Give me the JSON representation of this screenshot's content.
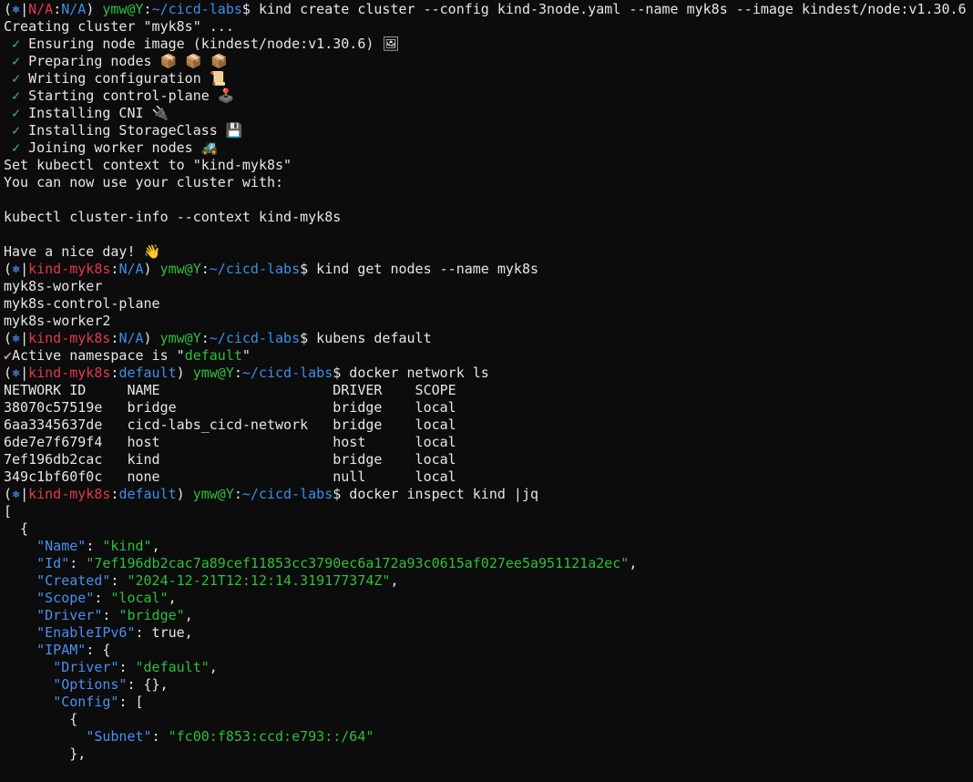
{
  "colors": {
    "background": "#0c0c0c",
    "text": "#cccccc",
    "red": "#e23a4a",
    "blue": "#3b8eea",
    "green": "#2fbf3a",
    "json_key": "#4a8ff0"
  },
  "terminal": {
    "lines": [
      [
        {
          "t": "(",
          "c": "white"
        },
        {
          "t": "⎈",
          "c": "k8s"
        },
        {
          "t": "|",
          "c": "white"
        },
        {
          "t": "N/A",
          "c": "red"
        },
        {
          "t": ":",
          "c": "white"
        },
        {
          "t": "N/A",
          "c": "blue"
        },
        {
          "t": ") ",
          "c": "white"
        },
        {
          "t": "ymw@Y",
          "c": "green"
        },
        {
          "t": ":",
          "c": "white"
        },
        {
          "t": "~/cicd-labs",
          "c": "blue"
        },
        {
          "t": "$ kind create cluster --config kind-3node.yaml --name myk8s --image kindest/node:v1.30.6",
          "c": "white"
        }
      ],
      [
        {
          "t": "Creating cluster \"myk8s\" ...",
          "c": "white"
        }
      ],
      [
        {
          "t": " ✓",
          "c": "check"
        },
        {
          "t": " Ensuring node image (kindest/node:v1.30.6) 🖼",
          "c": "white"
        }
      ],
      [
        {
          "t": " ✓",
          "c": "check"
        },
        {
          "t": " Preparing nodes 📦 📦 📦",
          "c": "white"
        }
      ],
      [
        {
          "t": " ✓",
          "c": "check"
        },
        {
          "t": " Writing configuration 📜",
          "c": "white"
        }
      ],
      [
        {
          "t": " ✓",
          "c": "check"
        },
        {
          "t": " Starting control-plane 🕹️",
          "c": "white"
        }
      ],
      [
        {
          "t": " ✓",
          "c": "check"
        },
        {
          "t": " Installing CNI 🔌",
          "c": "white"
        }
      ],
      [
        {
          "t": " ✓",
          "c": "check"
        },
        {
          "t": " Installing StorageClass 💾",
          "c": "white"
        }
      ],
      [
        {
          "t": " ✓",
          "c": "check"
        },
        {
          "t": " Joining worker nodes 🚜",
          "c": "white"
        }
      ],
      [
        {
          "t": "Set kubectl context to \"kind-myk8s\"",
          "c": "white"
        }
      ],
      [
        {
          "t": "You can now use your cluster with:",
          "c": "white"
        }
      ],
      [
        {
          "t": "",
          "c": "white"
        }
      ],
      [
        {
          "t": "kubectl cluster-info --context kind-myk8s",
          "c": "white"
        }
      ],
      [
        {
          "t": "",
          "c": "white"
        }
      ],
      [
        {
          "t": "Have a nice day! 👋",
          "c": "white"
        }
      ],
      [
        {
          "t": "(",
          "c": "white"
        },
        {
          "t": "⎈",
          "c": "k8s"
        },
        {
          "t": "|",
          "c": "white"
        },
        {
          "t": "kind-myk8s",
          "c": "red"
        },
        {
          "t": ":",
          "c": "white"
        },
        {
          "t": "N/A",
          "c": "blue"
        },
        {
          "t": ") ",
          "c": "white"
        },
        {
          "t": "ymw@Y",
          "c": "green"
        },
        {
          "t": ":",
          "c": "white"
        },
        {
          "t": "~/cicd-labs",
          "c": "blue"
        },
        {
          "t": "$ kind get nodes --name myk8s",
          "c": "white"
        }
      ],
      [
        {
          "t": "myk8s-worker",
          "c": "white"
        }
      ],
      [
        {
          "t": "myk8s-control-plane",
          "c": "white"
        }
      ],
      [
        {
          "t": "myk8s-worker2",
          "c": "white"
        }
      ],
      [
        {
          "t": "(",
          "c": "white"
        },
        {
          "t": "⎈",
          "c": "k8s"
        },
        {
          "t": "|",
          "c": "white"
        },
        {
          "t": "kind-myk8s",
          "c": "red"
        },
        {
          "t": ":",
          "c": "white"
        },
        {
          "t": "N/A",
          "c": "blue"
        },
        {
          "t": ") ",
          "c": "white"
        },
        {
          "t": "ymw@Y",
          "c": "green"
        },
        {
          "t": ":",
          "c": "white"
        },
        {
          "t": "~/cicd-labs",
          "c": "blue"
        },
        {
          "t": "$ kubens default",
          "c": "white"
        }
      ],
      [
        {
          "t": "✔",
          "c": "purple"
        },
        {
          "t": "Active namespace is \"",
          "c": "white"
        },
        {
          "t": "default",
          "c": "green"
        },
        {
          "t": "\"",
          "c": "white"
        }
      ],
      [
        {
          "t": "(",
          "c": "white"
        },
        {
          "t": "⎈",
          "c": "k8s"
        },
        {
          "t": "|",
          "c": "white"
        },
        {
          "t": "kind-myk8s",
          "c": "red"
        },
        {
          "t": ":",
          "c": "white"
        },
        {
          "t": "default",
          "c": "blue"
        },
        {
          "t": ") ",
          "c": "white"
        },
        {
          "t": "ymw@Y",
          "c": "green"
        },
        {
          "t": ":",
          "c": "white"
        },
        {
          "t": "~/cicd-labs",
          "c": "blue"
        },
        {
          "t": "$ docker network ls",
          "c": "white"
        }
      ],
      [
        {
          "t": "NETWORK ID     NAME                     DRIVER    SCOPE",
          "c": "white"
        }
      ],
      [
        {
          "t": "38070c57519e   bridge                   bridge    local",
          "c": "white"
        }
      ],
      [
        {
          "t": "6aa3345637de   cicd-labs_cicd-network   bridge    local",
          "c": "white"
        }
      ],
      [
        {
          "t": "6de7e7f679f4   host                     host      local",
          "c": "white"
        }
      ],
      [
        {
          "t": "7ef196db2cac   kind                     bridge    local",
          "c": "white"
        }
      ],
      [
        {
          "t": "349c1bf60f0c   none                     null      local",
          "c": "white"
        }
      ],
      [
        {
          "t": "(",
          "c": "white"
        },
        {
          "t": "⎈",
          "c": "k8s"
        },
        {
          "t": "|",
          "c": "white"
        },
        {
          "t": "kind-myk8s",
          "c": "red"
        },
        {
          "t": ":",
          "c": "white"
        },
        {
          "t": "default",
          "c": "blue"
        },
        {
          "t": ") ",
          "c": "white"
        },
        {
          "t": "ymw@Y",
          "c": "green"
        },
        {
          "t": ":",
          "c": "white"
        },
        {
          "t": "~/cicd-labs",
          "c": "blue"
        },
        {
          "t": "$ docker inspect kind |jq",
          "c": "white"
        }
      ],
      [
        {
          "t": "[",
          "c": "json-punct"
        }
      ],
      [
        {
          "t": "  {",
          "c": "json-punct"
        }
      ],
      [
        {
          "t": "    ",
          "c": "white"
        },
        {
          "t": "\"Name\"",
          "c": "json-key"
        },
        {
          "t": ": ",
          "c": "json-punct"
        },
        {
          "t": "\"kind\"",
          "c": "json-str"
        },
        {
          "t": ",",
          "c": "json-punct"
        }
      ],
      [
        {
          "t": "    ",
          "c": "white"
        },
        {
          "t": "\"Id\"",
          "c": "json-key"
        },
        {
          "t": ": ",
          "c": "json-punct"
        },
        {
          "t": "\"7ef196db2cac7a89cef11853cc3790ec6a172a93c0615af027ee5a951121a2ec\"",
          "c": "json-str"
        },
        {
          "t": ",",
          "c": "json-punct"
        }
      ],
      [
        {
          "t": "    ",
          "c": "white"
        },
        {
          "t": "\"Created\"",
          "c": "json-key"
        },
        {
          "t": ": ",
          "c": "json-punct"
        },
        {
          "t": "\"2024-12-21T12:12:14.319177374Z\"",
          "c": "json-str"
        },
        {
          "t": ",",
          "c": "json-punct"
        }
      ],
      [
        {
          "t": "    ",
          "c": "white"
        },
        {
          "t": "\"Scope\"",
          "c": "json-key"
        },
        {
          "t": ": ",
          "c": "json-punct"
        },
        {
          "t": "\"local\"",
          "c": "json-str"
        },
        {
          "t": ",",
          "c": "json-punct"
        }
      ],
      [
        {
          "t": "    ",
          "c": "white"
        },
        {
          "t": "\"Driver\"",
          "c": "json-key"
        },
        {
          "t": ": ",
          "c": "json-punct"
        },
        {
          "t": "\"bridge\"",
          "c": "json-str"
        },
        {
          "t": ",",
          "c": "json-punct"
        }
      ],
      [
        {
          "t": "    ",
          "c": "white"
        },
        {
          "t": "\"EnableIPv6\"",
          "c": "json-key"
        },
        {
          "t": ": true,",
          "c": "json-punct"
        }
      ],
      [
        {
          "t": "    ",
          "c": "white"
        },
        {
          "t": "\"IPAM\"",
          "c": "json-key"
        },
        {
          "t": ": {",
          "c": "json-punct"
        }
      ],
      [
        {
          "t": "      ",
          "c": "white"
        },
        {
          "t": "\"Driver\"",
          "c": "json-key"
        },
        {
          "t": ": ",
          "c": "json-punct"
        },
        {
          "t": "\"default\"",
          "c": "json-str"
        },
        {
          "t": ",",
          "c": "json-punct"
        }
      ],
      [
        {
          "t": "      ",
          "c": "white"
        },
        {
          "t": "\"Options\"",
          "c": "json-key"
        },
        {
          "t": ": {},",
          "c": "json-punct"
        }
      ],
      [
        {
          "t": "      ",
          "c": "white"
        },
        {
          "t": "\"Config\"",
          "c": "json-key"
        },
        {
          "t": ": [",
          "c": "json-punct"
        }
      ],
      [
        {
          "t": "        {",
          "c": "json-punct"
        }
      ],
      [
        {
          "t": "          ",
          "c": "white"
        },
        {
          "t": "\"Subnet\"",
          "c": "json-key"
        },
        {
          "t": ": ",
          "c": "json-punct"
        },
        {
          "t": "\"fc00:f853:ccd:e793::/64\"",
          "c": "json-str"
        }
      ],
      [
        {
          "t": "        },",
          "c": "json-punct"
        }
      ]
    ]
  }
}
